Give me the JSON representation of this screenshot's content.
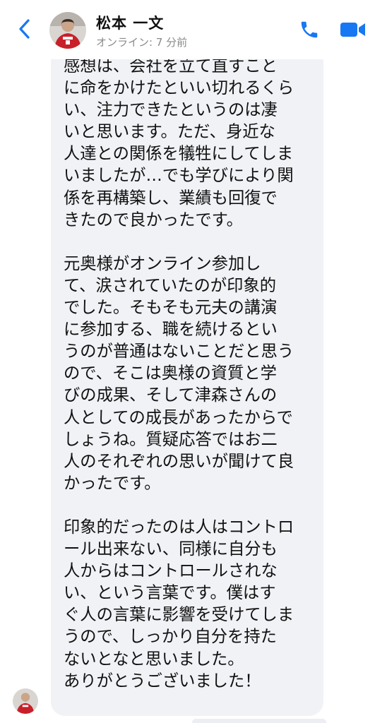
{
  "header": {
    "contact_name": "松本 一文",
    "status": "オンライン: 7 分前",
    "back_icon": "chevron-left-icon",
    "call_icon": "phone-icon",
    "video_icon": "video-camera-icon",
    "accent_color": "#1877f2"
  },
  "message": {
    "paragraphs": [
      "感想は、会社を立て直すこと\nに命をかけたといい切れるくら\nい、注力できたというのは凄\nいと思います。ただ、身近な\n人達との関係を犠牲にしてしま\nいましたが…でも学びにより関\n係を再構築し、業績も回復で\nきたので良かったです。",
      "元奥様がオンライン参加し\nて、涙されていたのが印象的\nでした。そもそも元夫の講演\nに参加する、職を続けるとい\nうのが普通はないことだと思う\nので、そこは奥様の資質と学\nびの成果、そして津森さんの\n人としての成長があったからで\nしょうね。質疑応答ではお二\n人のそれぞれの思いが聞けて良\nかったです。",
      "印象的だったのは人はコントロ\nール出来ない、同様に自分も\n人からはコントロールされな\nい、という言葉です。僕はす\nぐ人の言葉に影響を受けてしま\nうので、しっかり自分を持た\nないとなと思いました。\nありがとうございました！"
    ],
    "bubble_color": "#f1f2f6"
  }
}
